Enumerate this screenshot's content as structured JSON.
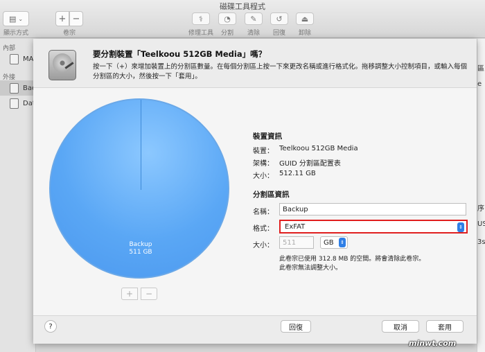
{
  "window": {
    "title": "磁碟工具程式",
    "view_label": "顯示方式",
    "volume_label": "卷宗",
    "plus": "+",
    "minus": "−",
    "tools": [
      {
        "icon": "stethoscope-icon",
        "glyph": "⚕",
        "label": "修理工具"
      },
      {
        "icon": "partition-icon",
        "glyph": "◔",
        "label": "分割"
      },
      {
        "icon": "erase-icon",
        "glyph": "✎",
        "label": "清除"
      },
      {
        "icon": "restore-icon",
        "glyph": "↺",
        "label": "回復"
      },
      {
        "icon": "unmount-icon",
        "glyph": "⏏",
        "label": "卸除"
      }
    ]
  },
  "sidebar": {
    "internal_heading": "內部",
    "external_heading": "外接",
    "items": [
      {
        "label": "MA",
        "icon": "disk-icon"
      },
      {
        "label": "Back",
        "icon": "disk-icon"
      },
      {
        "label": "Dat",
        "icon": "disk-icon"
      }
    ]
  },
  "background_right": {
    "fragments": [
      "區",
      "e",
      "序",
      "US",
      "3s"
    ]
  },
  "sheet": {
    "title": "要分割裝置「Teelkoou 512GB Media」嗎？",
    "description": "按一下（+）來增加裝置上的分割區數量。在每個分割區上按一下來更改名稱或進行格式化。拖移調整大小控制項目，或輸入每個分割區的大小，然後按一下「套用」。",
    "pie": {
      "name": "Backup",
      "size": "511 GB",
      "fraction": 1.0
    },
    "add_partition": "+",
    "remove_partition": "−",
    "device_info_heading": "裝置資訊",
    "device_info": [
      {
        "key": "裝置：",
        "value": "Teelkoou 512GB Media"
      },
      {
        "key": "架構：",
        "value": "GUID 分割區配置表"
      },
      {
        "key": "大小：",
        "value": "512.11 GB"
      }
    ],
    "partition_info_heading": "分割區資訊",
    "name_label": "名稱：",
    "name_value": "Backup",
    "format_label": "格式：",
    "format_value": "ExFAT",
    "size_label": "大小：",
    "size_value": "511",
    "size_unit": "GB",
    "note_line1": "此卷宗已使用 312.8 MB 的空間。將會清除此卷宗。",
    "note_line2": "此卷宗無法調整大小。",
    "help": "?",
    "revert": "回復",
    "cancel": "取消",
    "apply": "套用"
  },
  "watermark": "minwt.com",
  "colors": {
    "highlight": "#e01e1e",
    "accent": "#2f7fe6",
    "pie": "#5aa7f5"
  }
}
